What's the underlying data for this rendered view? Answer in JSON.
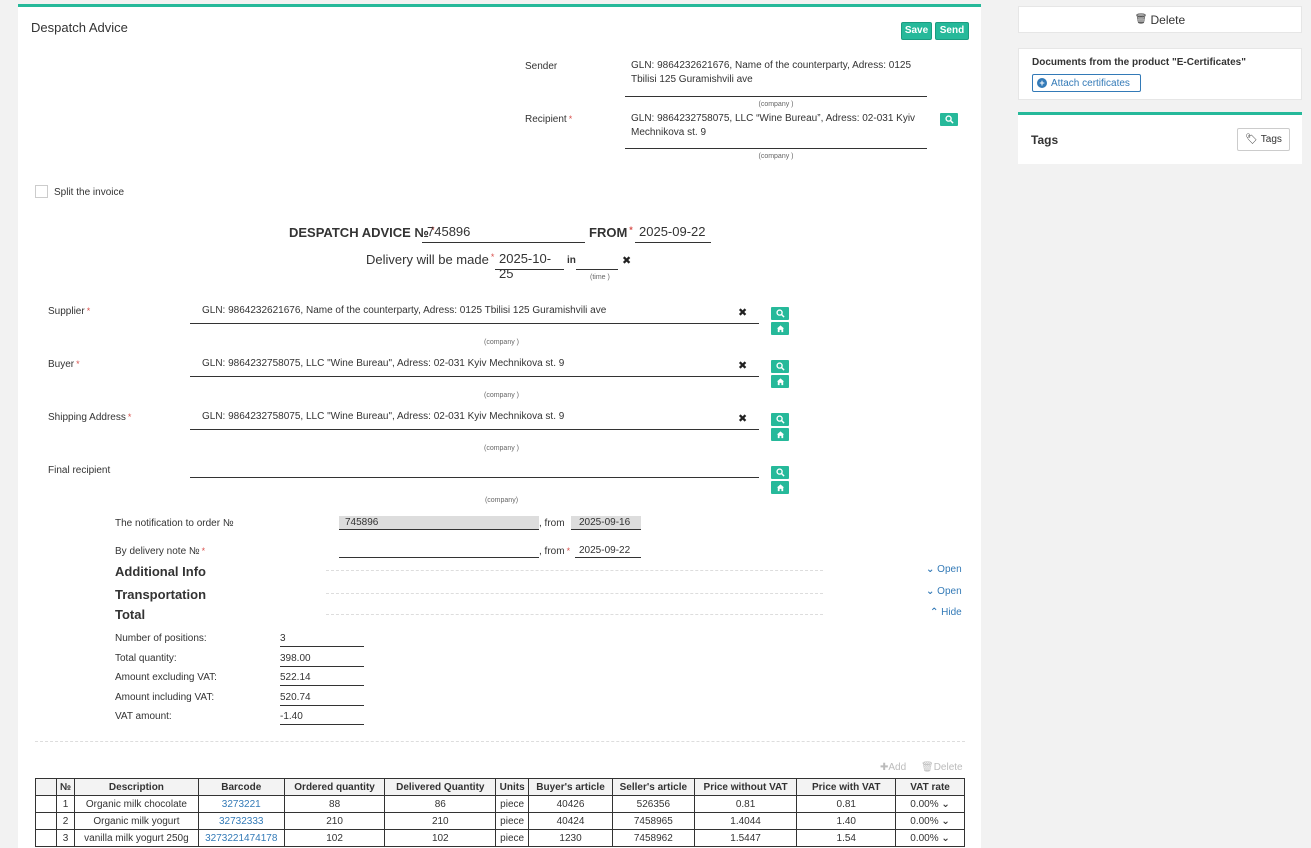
{
  "header": {
    "title": "Despatch Advice",
    "save_label": "Save",
    "send_label": "Send"
  },
  "sender": {
    "label": "Sender",
    "value": "GLN: 9864232621676, Name of the counterparty, Adress: 0125 Tbilisi 125 Guramishvili ave",
    "hint": "(company )"
  },
  "recipient": {
    "label": "Recipient",
    "value": "GLN: 9864232758075, LLC “Wine Bureau”, Adress: 02-031 Kyiv Mechnikova st. 9",
    "hint": "(company )"
  },
  "split": {
    "label": "Split the invoice"
  },
  "doc": {
    "number_label": "DESPATCH ADVICE №",
    "number": "745896",
    "from_label": "FROM",
    "date": "2025-09-22",
    "delivery_label": "Delivery will be made",
    "delivery_date": "2025-10-25",
    "in_label": "in",
    "time_hint": "(time )"
  },
  "parties": [
    {
      "label": "Supplier",
      "value": "GLN: 9864232621676, Name of the counterparty, Adress: 0125 Tbilisi 125 Guramishvili ave",
      "hint": "(company )"
    },
    {
      "label": "Buyer",
      "value": "GLN: 9864232758075, LLC \"Wine Bureau\", Adress: 02-031 Kyiv Mechnikova st. 9",
      "hint": "(company )"
    },
    {
      "label": "Shipping Address",
      "value": "GLN: 9864232758075, LLC \"Wine Bureau\", Adress: 02-031 Kyiv Mechnikova st. 9",
      "hint": "(company )"
    },
    {
      "label": "Final recipient",
      "value": "",
      "hint": "(company)"
    }
  ],
  "order": {
    "label": "The notification to order №",
    "number": "745896",
    "from_label": ", from",
    "date": "2025-09-16"
  },
  "delivery_note": {
    "label": "By delivery note №",
    "number": "",
    "from_label": ", from",
    "date": "2025-09-22"
  },
  "sections": {
    "additional": {
      "title": "Additional Info",
      "toggle": "Open"
    },
    "transportation": {
      "title": "Transportation",
      "toggle": "Open"
    },
    "total": {
      "title": "Total",
      "toggle": "Hide"
    }
  },
  "totals": [
    {
      "label": "Number of positions:",
      "value": "3"
    },
    {
      "label": "Total quantity:",
      "value": "398.00"
    },
    {
      "label": "Amount excluding VAT:",
      "value": "522.14"
    },
    {
      "label": "Amount including VAT:",
      "value": "520.74"
    },
    {
      "label": "VAT amount:",
      "value": "-1.40"
    }
  ],
  "table_actions": {
    "add": "Add",
    "delete": "Delete"
  },
  "table": {
    "headers": [
      "",
      "№",
      "Description",
      "Barcode",
      "Ordered quantity",
      "Delivered Quantity",
      "Units",
      "Buyer's article",
      "Seller's article",
      "Price without VAT",
      "Price with VAT",
      "VAT rate"
    ],
    "rows": [
      [
        "1",
        "Organic milk chocolate",
        "3273221",
        "88",
        "86",
        "piece",
        "40426",
        "526356",
        "0.81",
        "0.81",
        "0.00%"
      ],
      [
        "2",
        "Organic milk yogurt",
        "32732333",
        "210",
        "210",
        "piece",
        "40424",
        "7458965",
        "1.4044",
        "1.40",
        "0.00%"
      ],
      [
        "3",
        "vanilla milk yogurt 250g",
        "3273221474178",
        "102",
        "102",
        "piece",
        "1230",
        "7458962",
        "1.5447",
        "1.54",
        "0.00%"
      ]
    ]
  },
  "sidebar": {
    "delete_label": "Delete",
    "certs_title": "Documents from the product \"E-Certificates\"",
    "attach_label": "Attach certificates",
    "tags_title": "Tags",
    "tags_button": "Tags"
  },
  "colors": {
    "accent": "#26b99a",
    "link": "#337ab7",
    "required": "#d9534f"
  }
}
